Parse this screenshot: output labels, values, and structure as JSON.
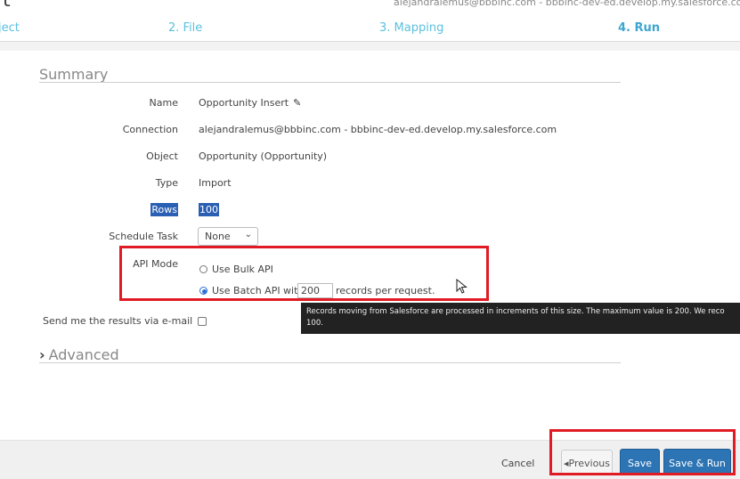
{
  "header": {
    "title_fragment": "rt",
    "user_info": "alejandralemus@bbbinc.com - bbbinc-dev-ed.develop.my.salesforce.com"
  },
  "steps": [
    {
      "label": "ject",
      "active": false
    },
    {
      "label": "2. File",
      "active": false
    },
    {
      "label": "3. Mapping",
      "active": false
    },
    {
      "label": "4. Run",
      "active": true
    }
  ],
  "summary": {
    "heading": "Summary",
    "fields": {
      "name_label": "Name",
      "name_value": "Opportunity Insert",
      "connection_label": "Connection",
      "connection_value": "alejandralemus@bbbinc.com - bbbinc-dev-ed.develop.my.salesforce.com",
      "object_label": "Object",
      "object_value": "Opportunity (Opportunity)",
      "type_label": "Type",
      "type_value": "Import",
      "rows_label": "Rows",
      "rows_value": "100",
      "schedule_label": "Schedule Task",
      "schedule_value": "None",
      "api_label": "API Mode",
      "api_option_bulk": "Use Bulk API",
      "api_option_batch_prefix": "Use Batch API with",
      "api_batch_size": "200",
      "api_option_batch_suffix": "records per request.",
      "api_selected": "batch",
      "email_label": "Send me the results via e-mail",
      "email_checked": false
    }
  },
  "tooltip": {
    "line1": "Records moving from Salesforce are processed in increments of this size. The maximum value is 200. We reco",
    "line2": "100."
  },
  "advanced": {
    "heading": "Advanced"
  },
  "footer": {
    "cancel": "Cancel",
    "previous": "Previous",
    "save": "Save",
    "save_run": "Save & Run"
  },
  "icons": {
    "edit": "pencil-icon",
    "expand": "chevron-right-icon",
    "dropdown": "chevron-down-icon",
    "previous": "caret-left-icon"
  },
  "colors": {
    "accent": "#5bc0de",
    "primary_button": "#2c74b3",
    "annotation": "#e01b24",
    "selection": "#2b5fb3"
  }
}
